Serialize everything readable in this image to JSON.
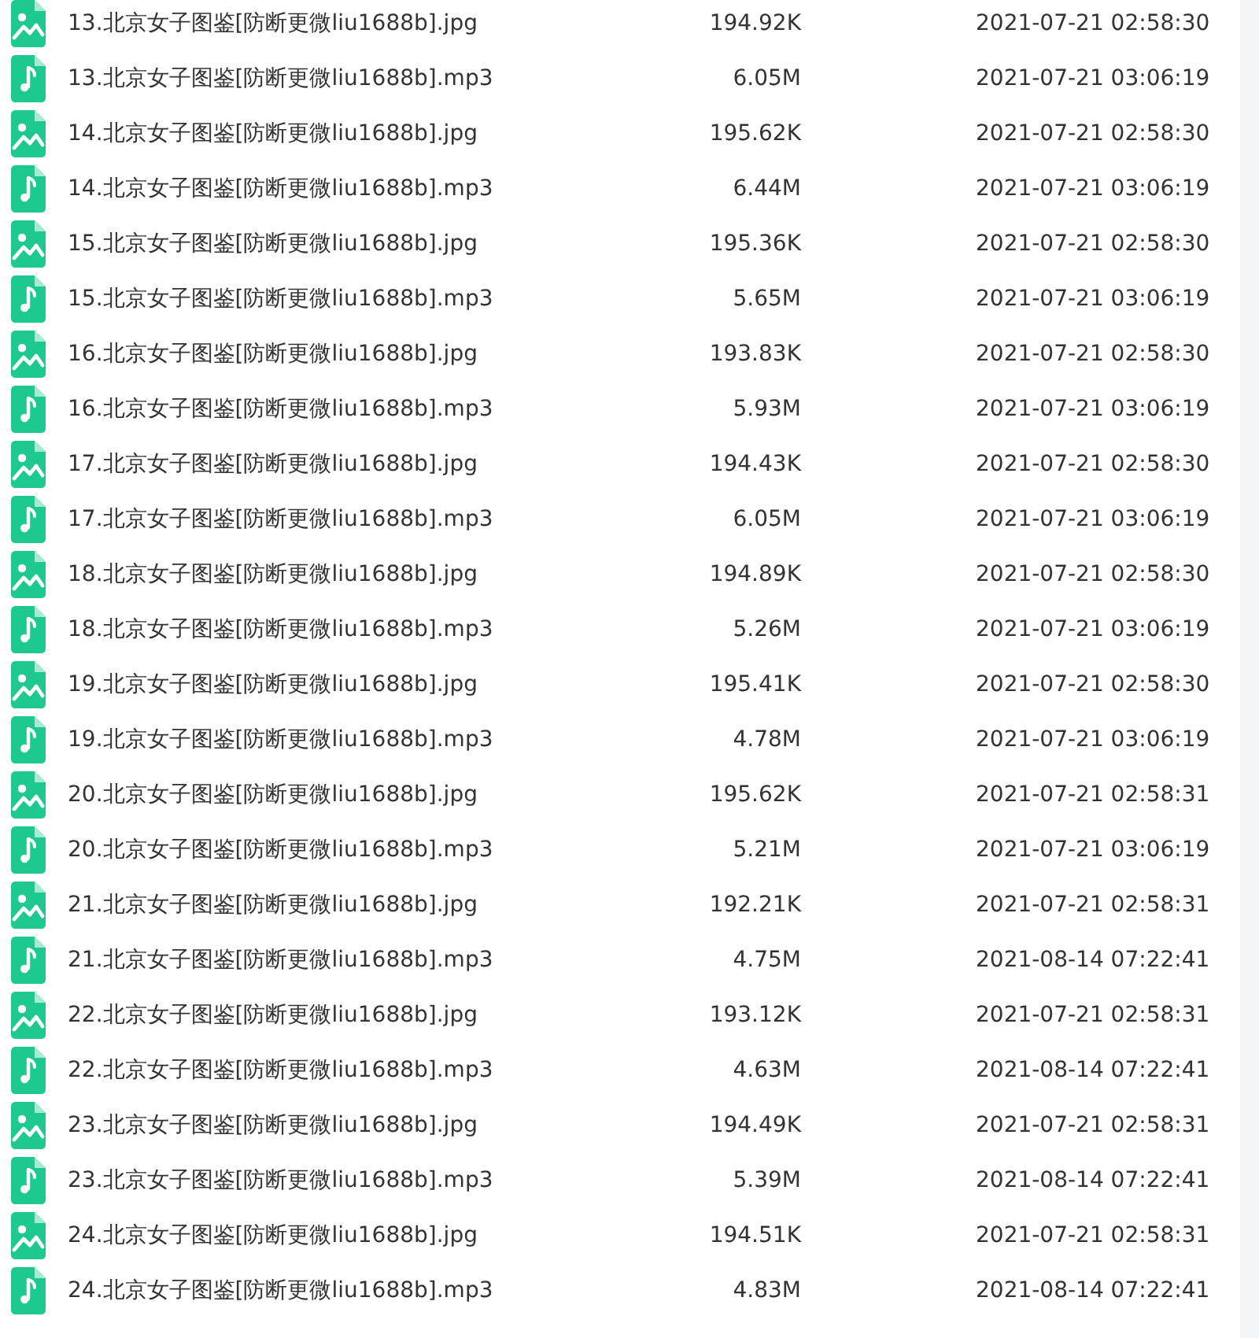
{
  "files": [
    {
      "kind": "image",
      "name": "13.北京女子图鉴[防断更微liu1688b].jpg",
      "size": "194.92K",
      "modified": "2021-07-21 02:58:30"
    },
    {
      "kind": "audio",
      "name": "13.北京女子图鉴[防断更微liu1688b].mp3",
      "size": "6.05M",
      "modified": "2021-07-21 03:06:19"
    },
    {
      "kind": "image",
      "name": "14.北京女子图鉴[防断更微liu1688b].jpg",
      "size": "195.62K",
      "modified": "2021-07-21 02:58:30"
    },
    {
      "kind": "audio",
      "name": "14.北京女子图鉴[防断更微liu1688b].mp3",
      "size": "6.44M",
      "modified": "2021-07-21 03:06:19"
    },
    {
      "kind": "image",
      "name": "15.北京女子图鉴[防断更微liu1688b].jpg",
      "size": "195.36K",
      "modified": "2021-07-21 02:58:30"
    },
    {
      "kind": "audio",
      "name": "15.北京女子图鉴[防断更微liu1688b].mp3",
      "size": "5.65M",
      "modified": "2021-07-21 03:06:19"
    },
    {
      "kind": "image",
      "name": "16.北京女子图鉴[防断更微liu1688b].jpg",
      "size": "193.83K",
      "modified": "2021-07-21 02:58:30"
    },
    {
      "kind": "audio",
      "name": "16.北京女子图鉴[防断更微liu1688b].mp3",
      "size": "5.93M",
      "modified": "2021-07-21 03:06:19"
    },
    {
      "kind": "image",
      "name": "17.北京女子图鉴[防断更微liu1688b].jpg",
      "size": "194.43K",
      "modified": "2021-07-21 02:58:30"
    },
    {
      "kind": "audio",
      "name": "17.北京女子图鉴[防断更微liu1688b].mp3",
      "size": "6.05M",
      "modified": "2021-07-21 03:06:19"
    },
    {
      "kind": "image",
      "name": "18.北京女子图鉴[防断更微liu1688b].jpg",
      "size": "194.89K",
      "modified": "2021-07-21 02:58:30"
    },
    {
      "kind": "audio",
      "name": "18.北京女子图鉴[防断更微liu1688b].mp3",
      "size": "5.26M",
      "modified": "2021-07-21 03:06:19"
    },
    {
      "kind": "image",
      "name": "19.北京女子图鉴[防断更微liu1688b].jpg",
      "size": "195.41K",
      "modified": "2021-07-21 02:58:30"
    },
    {
      "kind": "audio",
      "name": "19.北京女子图鉴[防断更微liu1688b].mp3",
      "size": "4.78M",
      "modified": "2021-07-21 03:06:19"
    },
    {
      "kind": "image",
      "name": "20.北京女子图鉴[防断更微liu1688b].jpg",
      "size": "195.62K",
      "modified": "2021-07-21 02:58:31"
    },
    {
      "kind": "audio",
      "name": "20.北京女子图鉴[防断更微liu1688b].mp3",
      "size": "5.21M",
      "modified": "2021-07-21 03:06:19"
    },
    {
      "kind": "image",
      "name": "21.北京女子图鉴[防断更微liu1688b].jpg",
      "size": "192.21K",
      "modified": "2021-07-21 02:58:31"
    },
    {
      "kind": "audio",
      "name": "21.北京女子图鉴[防断更微liu1688b].mp3",
      "size": "4.75M",
      "modified": "2021-08-14 07:22:41"
    },
    {
      "kind": "image",
      "name": "22.北京女子图鉴[防断更微liu1688b].jpg",
      "size": "193.12K",
      "modified": "2021-07-21 02:58:31"
    },
    {
      "kind": "audio",
      "name": "22.北京女子图鉴[防断更微liu1688b].mp3",
      "size": "4.63M",
      "modified": "2021-08-14 07:22:41"
    },
    {
      "kind": "image",
      "name": "23.北京女子图鉴[防断更微liu1688b].jpg",
      "size": "194.49K",
      "modified": "2021-07-21 02:58:31"
    },
    {
      "kind": "audio",
      "name": "23.北京女子图鉴[防断更微liu1688b].mp3",
      "size": "5.39M",
      "modified": "2021-08-14 07:22:41"
    },
    {
      "kind": "image",
      "name": "24.北京女子图鉴[防断更微liu1688b].jpg",
      "size": "194.51K",
      "modified": "2021-07-21 02:58:31"
    },
    {
      "kind": "audio",
      "name": "24.北京女子图鉴[防断更微liu1688b].mp3",
      "size": "4.83M",
      "modified": "2021-08-14 07:22:41"
    }
  ]
}
